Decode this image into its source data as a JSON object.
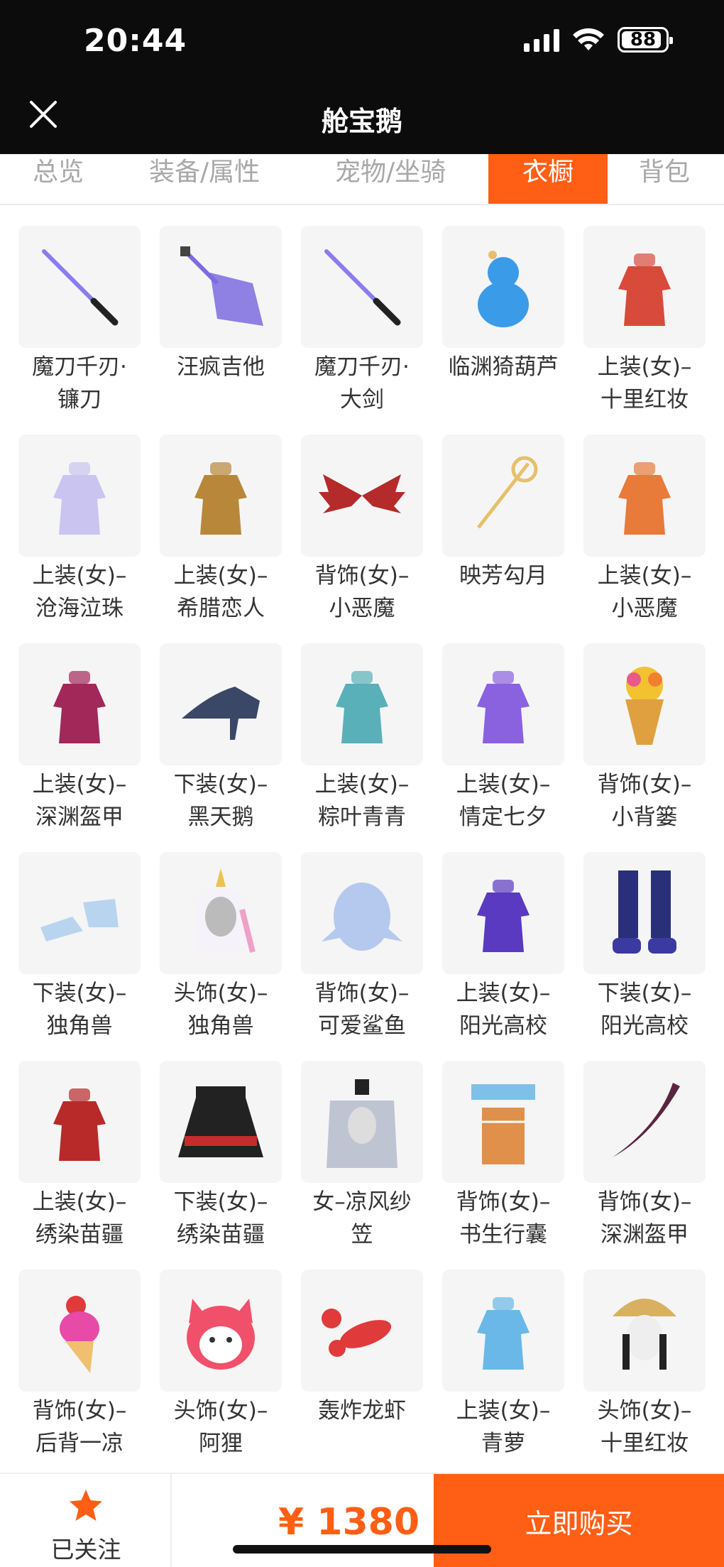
{
  "status_bar": {
    "time": "20:44",
    "battery": "88"
  },
  "header": {
    "title": "舱宝鹅",
    "close_icon": "close-icon"
  },
  "tabs": [
    {
      "label": "总览",
      "active": false
    },
    {
      "label": "装备/属性",
      "active": false
    },
    {
      "label": "宠物/坐骑",
      "active": false
    },
    {
      "label": "衣橱",
      "active": true
    },
    {
      "label": "背包",
      "active": false
    }
  ],
  "items": [
    {
      "line1": "魔刀千刃·",
      "line2": "镰刀",
      "icon": "katana-icon",
      "color": "#8a7cf0"
    },
    {
      "line1": "汪疯吉他",
      "line2": "",
      "icon": "guitar-icon",
      "color": "#7d6be0"
    },
    {
      "line1": "魔刀千刃·",
      "line2": "大剑",
      "icon": "katana-icon",
      "color": "#8a7cf0"
    },
    {
      "line1": "临渊猗葫芦",
      "line2": "",
      "icon": "gourd-icon",
      "color": "#3a9be8"
    },
    {
      "line1": "上装(女)–",
      "line2": "十里红妆",
      "icon": "dress-icon",
      "color": "#d84a3a"
    },
    {
      "line1": "上装(女)–",
      "line2": "沧海泣珠",
      "icon": "dress-icon",
      "color": "#c9c4f0"
    },
    {
      "line1": "上装(女)–",
      "line2": "希腊恋人",
      "icon": "dress-icon",
      "color": "#b8873a"
    },
    {
      "line1": "背饰(女)–",
      "line2": "小恶魔",
      "icon": "wings-icon",
      "color": "#b52a2a"
    },
    {
      "line1": "映芳勾月",
      "line2": "",
      "icon": "staff-icon",
      "color": "#e6c06a"
    },
    {
      "line1": "上装(女)–",
      "line2": "小恶魔",
      "icon": "dress-icon",
      "color": "#e87a3a"
    },
    {
      "line1": "上装(女)–",
      "line2": "深渊盔甲",
      "icon": "dress-icon",
      "color": "#a3285a"
    },
    {
      "line1": "下装(女)–",
      "line2": "黑天鹅",
      "icon": "heel-icon",
      "color": "#3b4766"
    },
    {
      "line1": "上装(女)–",
      "line2": "粽叶青青",
      "icon": "dress-icon",
      "color": "#5ab0b8"
    },
    {
      "line1": "上装(女)–",
      "line2": "情定七夕",
      "icon": "dress-icon",
      "color": "#8a62e0"
    },
    {
      "line1": "背饰(女)–",
      "line2": "小背篓",
      "icon": "basket-icon",
      "color": "#e0a040"
    },
    {
      "line1": "下装(女)–",
      "line2": "独角兽",
      "icon": "shoes-icon",
      "color": "#b9d4ee"
    },
    {
      "line1": "头饰(女)–",
      "line2": "独角兽",
      "icon": "hood-icon",
      "color": "#f0a0c8"
    },
    {
      "line1": "背饰(女)–",
      "line2": "可爱鲨鱼",
      "icon": "shark-icon",
      "color": "#b5c8ee"
    },
    {
      "line1": "上装(女)–",
      "line2": "阳光高校",
      "icon": "dress-icon",
      "color": "#5a3ac0"
    },
    {
      "line1": "下装(女)–",
      "line2": "阳光高校",
      "icon": "boots-icon",
      "color": "#2a2f7a"
    },
    {
      "line1": "上装(女)–",
      "line2": "绣染苗疆",
      "icon": "dress-icon",
      "color": "#b82a2a"
    },
    {
      "line1": "下装(女)–",
      "line2": "绣染苗疆",
      "icon": "skirt-icon",
      "color": "#c42d2d"
    },
    {
      "line1": "女–凉风纱",
      "line2": "笠",
      "icon": "hat-icon",
      "color": "#7f8aa8"
    },
    {
      "line1": "背饰(女)–",
      "line2": "书生行囊",
      "icon": "pack-icon",
      "color": "#e0904a"
    },
    {
      "line1": "背饰(女)–",
      "line2": "深渊盔甲",
      "icon": "blade-icon",
      "color": "#5a2540"
    },
    {
      "line1": "背饰(女)–",
      "line2": "后背一凉",
      "icon": "icecream-icon",
      "color": "#e84aa8"
    },
    {
      "line1": "头饰(女)–",
      "line2": "阿狸",
      "icon": "fox-icon",
      "color": "#f0506a"
    },
    {
      "line1": "轰炸龙虾",
      "line2": "",
      "icon": "lobster-icon",
      "color": "#e03a3a"
    },
    {
      "line1": "上装(女)–",
      "line2": "青萝",
      "icon": "dress-icon",
      "color": "#6ab8e8"
    },
    {
      "line1": "头饰(女)–",
      "line2": "十里红妆",
      "icon": "headdress-icon",
      "color": "#d8b060"
    }
  ],
  "bottom_bar": {
    "follow_label": "已关注",
    "price": "¥ 1380",
    "buy_label": "立即购买"
  },
  "colors": {
    "accent": "#ff5e15",
    "header_bg": "#0c0c0c"
  }
}
